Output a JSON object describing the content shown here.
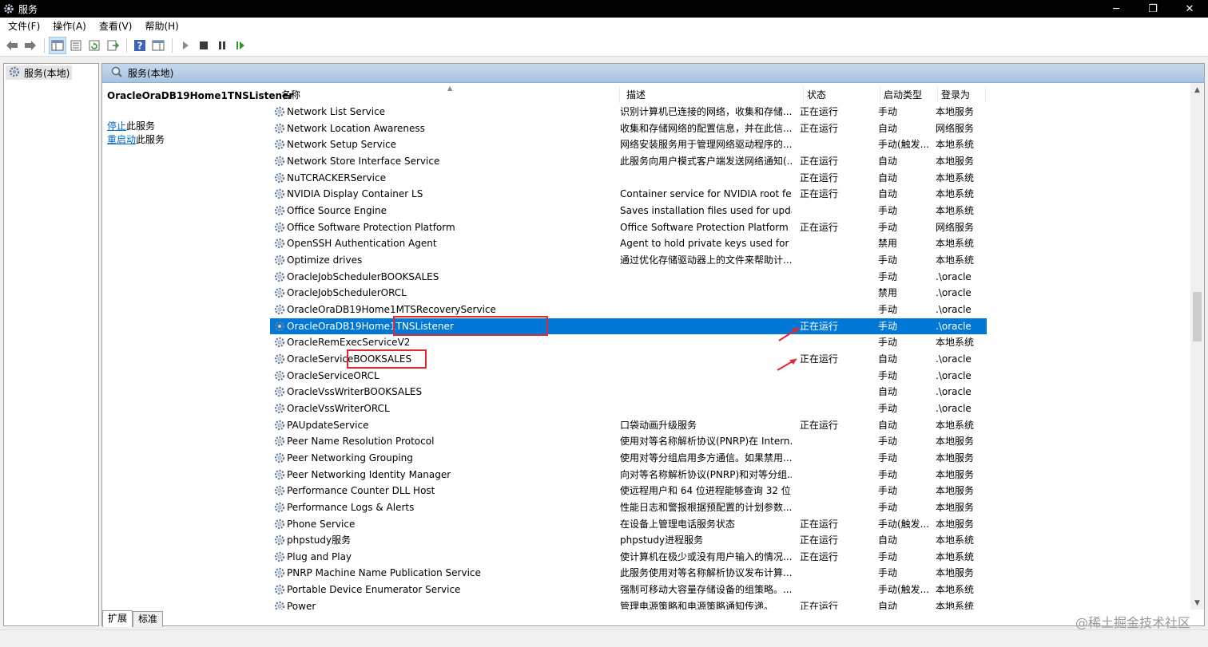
{
  "window": {
    "title": "服务",
    "minimize": "─",
    "restore": "❐",
    "close": "✕"
  },
  "menu": [
    "文件(F)",
    "操作(A)",
    "查看(V)",
    "帮助(H)"
  ],
  "toolbar": {
    "icons": [
      "back-icon",
      "forward-icon",
      "show-hide-console-tree-icon",
      "properties-icon",
      "refresh-icon",
      "export-list-icon",
      "help-icon",
      "show-hide-action-pane-icon",
      "start-service-icon",
      "stop-service-icon",
      "pause-service-icon",
      "resume-service-icon"
    ]
  },
  "tree": {
    "root_label": "服务(本地)"
  },
  "panel": {
    "header": "服务(本地)",
    "selected_service": "OracleOraDB19Home1TNSListener",
    "actions": [
      {
        "link": "停止",
        "suffix": "此服务"
      },
      {
        "link": "重启动",
        "suffix": "此服务"
      }
    ]
  },
  "columns": {
    "name": "名称",
    "desc": "描述",
    "status": "状态",
    "startup": "启动类型",
    "logon": "登录为"
  },
  "rows": [
    {
      "name": "Network List Service",
      "desc": "识别计算机已连接的网络，收集和存储...",
      "status": "正在运行",
      "startup": "手动",
      "logon": "本地服务"
    },
    {
      "name": "Network Location Awareness",
      "desc": "收集和存储网络的配置信息，并在此信...",
      "status": "正在运行",
      "startup": "自动",
      "logon": "网络服务"
    },
    {
      "name": "Network Setup Service",
      "desc": "网络安装服务用于管理网络驱动程序的...",
      "status": "",
      "startup": "手动(触发...",
      "logon": "本地系统"
    },
    {
      "name": "Network Store Interface Service",
      "desc": "此服务向用户模式客户端发送网络通知(...",
      "status": "正在运行",
      "startup": "自动",
      "logon": "本地服务"
    },
    {
      "name": "NuTCRACKERService",
      "desc": "",
      "status": "正在运行",
      "startup": "自动",
      "logon": "本地系统"
    },
    {
      "name": "NVIDIA Display Container LS",
      "desc": "Container service for NVIDIA root feat...",
      "status": "正在运行",
      "startup": "自动",
      "logon": "本地系统"
    },
    {
      "name": "Office  Source Engine",
      "desc": "Saves installation files used for update...",
      "status": "",
      "startup": "手动",
      "logon": "本地系统"
    },
    {
      "name": "Office Software Protection Platform",
      "desc": "Office Software Protection Platform S...",
      "status": "正在运行",
      "startup": "手动",
      "logon": "网络服务"
    },
    {
      "name": "OpenSSH Authentication Agent",
      "desc": "Agent to hold private keys used for pu...",
      "status": "",
      "startup": "禁用",
      "logon": "本地系统"
    },
    {
      "name": "Optimize drives",
      "desc": "通过优化存储驱动器上的文件来帮助计...",
      "status": "",
      "startup": "手动",
      "logon": "本地系统"
    },
    {
      "name": "OracleJobSchedulerBOOKSALES",
      "desc": "",
      "status": "",
      "startup": "手动",
      "logon": ".\\oracle"
    },
    {
      "name": "OracleJobSchedulerORCL",
      "desc": "",
      "status": "",
      "startup": "禁用",
      "logon": ".\\oracle"
    },
    {
      "name": "OracleOraDB19Home1MTSRecoveryService",
      "desc": "",
      "status": "",
      "startup": "手动",
      "logon": ".\\oracle"
    },
    {
      "name": "OracleOraDB19Home1TNSListener",
      "desc": "",
      "status": "正在运行",
      "startup": "手动",
      "logon": ".\\oracle",
      "selected": true
    },
    {
      "name": "OracleRemExecServiceV2",
      "desc": "",
      "status": "",
      "startup": "手动",
      "logon": "本地系统"
    },
    {
      "name": "OracleServiceBOOKSALES",
      "desc": "",
      "status": "正在运行",
      "startup": "自动",
      "logon": ".\\oracle"
    },
    {
      "name": "OracleServiceORCL",
      "desc": "",
      "status": "",
      "startup": "手动",
      "logon": ".\\oracle"
    },
    {
      "name": "OracleVssWriterBOOKSALES",
      "desc": "",
      "status": "",
      "startup": "自动",
      "logon": ".\\oracle"
    },
    {
      "name": "OracleVssWriterORCL",
      "desc": "",
      "status": "",
      "startup": "手动",
      "logon": ".\\oracle"
    },
    {
      "name": "PAUpdateService",
      "desc": "口袋动画升级服务",
      "status": "正在运行",
      "startup": "自动",
      "logon": "本地系统"
    },
    {
      "name": "Peer Name Resolution Protocol",
      "desc": "使用对等名称解析协议(PNRP)在 Intern...",
      "status": "",
      "startup": "手动",
      "logon": "本地服务"
    },
    {
      "name": "Peer Networking Grouping",
      "desc": "使用对等分组启用多方通信。如果禁用...",
      "status": "",
      "startup": "手动",
      "logon": "本地服务"
    },
    {
      "name": "Peer Networking Identity Manager",
      "desc": "向对等名称解析协议(PNRP)和对等分组...",
      "status": "",
      "startup": "手动",
      "logon": "本地服务"
    },
    {
      "name": "Performance Counter DLL Host",
      "desc": "使远程用户和 64 位进程能够查询 32 位...",
      "status": "",
      "startup": "手动",
      "logon": "本地服务"
    },
    {
      "name": "Performance Logs & Alerts",
      "desc": "性能日志和警报根据预配置的计划参数...",
      "status": "",
      "startup": "手动",
      "logon": "本地服务"
    },
    {
      "name": "Phone Service",
      "desc": "在设备上管理电话服务状态",
      "status": "正在运行",
      "startup": "手动(触发...",
      "logon": "本地服务"
    },
    {
      "name": "phpstudy服务",
      "desc": "phpstudy进程服务",
      "status": "正在运行",
      "startup": "自动",
      "logon": "本地系统"
    },
    {
      "name": "Plug and Play",
      "desc": "使计算机在极少或没有用户输入的情况...",
      "status": "正在运行",
      "startup": "手动",
      "logon": "本地系统"
    },
    {
      "name": "PNRP Machine Name Publication Service",
      "desc": "此服务使用对等名称解析协议发布计算...",
      "status": "",
      "startup": "手动",
      "logon": "本地服务"
    },
    {
      "name": "Portable Device Enumerator Service",
      "desc": "强制可移动大容量存储设备的组策略。...",
      "status": "",
      "startup": "手动(触发...",
      "logon": "本地系统"
    },
    {
      "name": "Power",
      "desc": "管理电源策略和电源策略通知传递。",
      "status": "正在运行",
      "startup": "自动",
      "logon": "本地系统"
    }
  ],
  "tabs": [
    "扩展",
    "标准"
  ],
  "watermark": "@稀土掘金技术社区",
  "colors": {
    "selection": "#0078d7",
    "annotation": "#e0282e",
    "header_gradient": "#b8cfe6"
  }
}
